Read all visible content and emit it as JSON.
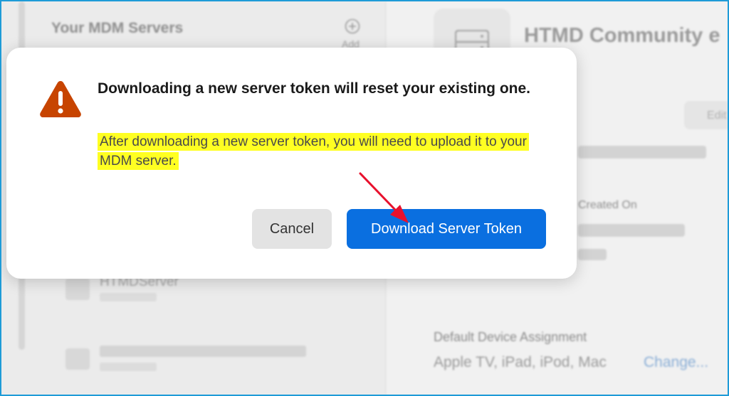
{
  "background": {
    "sidebar": {
      "title": "Your MDM Servers",
      "add_label": "Add",
      "servers": [
        {
          "name": "HTMDServer"
        }
      ]
    },
    "detail": {
      "title": "HTMD Community e",
      "edit_label": "Edit",
      "created_on_label": "Created On",
      "default_assignment_label": "Default Device Assignment",
      "default_assignment_value": "Apple TV, iPad, iPod, Mac",
      "change_link": "Change..."
    }
  },
  "dialog": {
    "icon": "warning-triangle-icon",
    "title": "Downloading a new server token will reset your existing one.",
    "message": "After downloading a new server token, you will need to upload it to your MDM server.",
    "cancel_label": "Cancel",
    "confirm_label": "Download Server Token"
  },
  "colors": {
    "frame_border": "#1e9bd7",
    "primary_button": "#0a6fe0",
    "warning_icon": "#c74400",
    "highlight": "#ffff22",
    "annotation_arrow": "#e8112d"
  }
}
